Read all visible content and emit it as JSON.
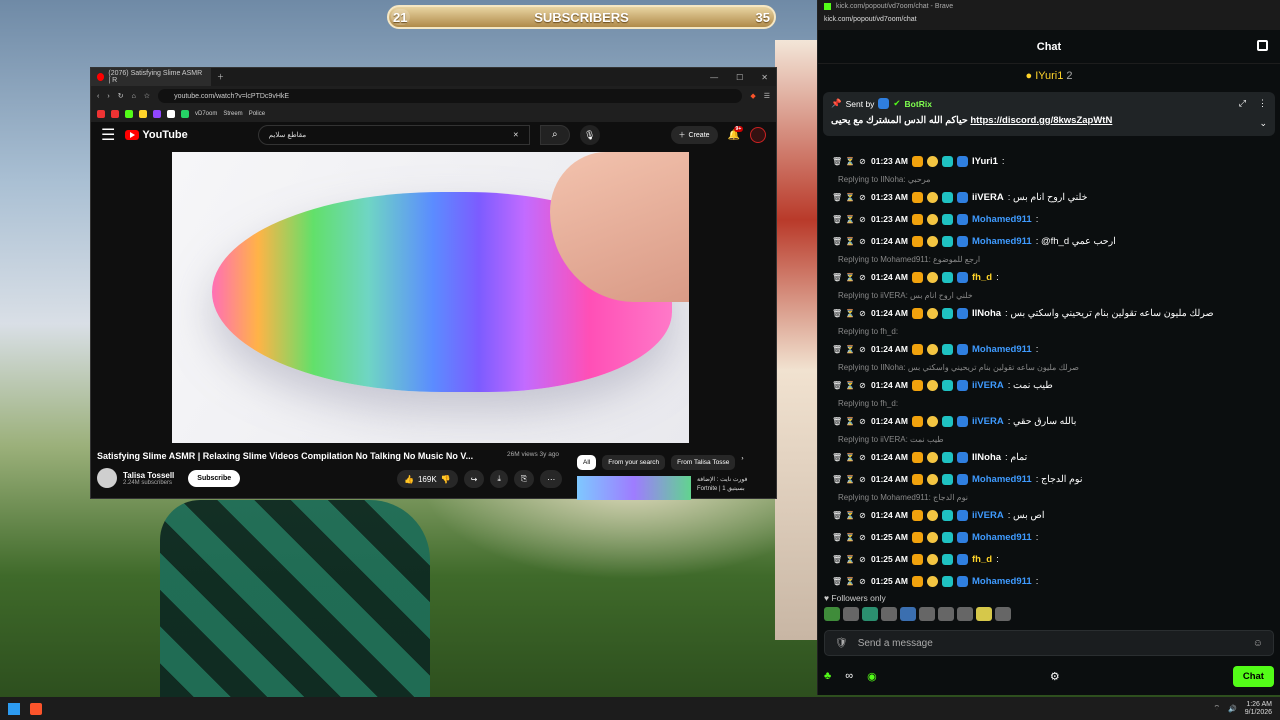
{
  "overlay": {
    "sub_start": "21",
    "sub_label": "SUBSCRIBERS",
    "sub_end": "35",
    "progress": 0.05
  },
  "browser": {
    "tab_title": "(2076) Satisfying Slime ASMR | R",
    "url": "youtube.com/watch?v=lcPTDc9vHkE",
    "bookmarks": [
      "vD7oom",
      "Streem",
      "Police"
    ]
  },
  "youtube": {
    "logo": "YouTube",
    "search_query": "مقاطع سلايم",
    "create_label": "Create",
    "notifications": "9+",
    "video_title": "Satisfying Slime ASMR | Relaxing Slime Videos Compilation No Talking No Music No V...",
    "views": "26M views",
    "age": "3y ago",
    "channel_name": "Talisa Tossell",
    "channel_subs": "2.24M subscribers",
    "subscribe_label": "Subscribe",
    "likes": "169K",
    "chips": [
      "All",
      "From your search",
      "From Talisa Tosse"
    ],
    "rec_line1": "فورت نايت : الإضافة",
    "rec_line2": "Fortnite | 1 بسيتيق"
  },
  "chat": {
    "window_title": "kick.com/popout/vd7oom/chat - Brave",
    "url": "kick.com/popout/vd7oom/chat",
    "header": "Chat",
    "pinned_user": "IYuri1",
    "pinned_count": "2",
    "sent_by": "Sent by",
    "bot_name": "BotRix",
    "pinned_message": "حياكم الله الدس المشترك مع يحيى",
    "pinned_link": "https://discord.gg/8kwsZapWtN",
    "messages": [
      {
        "reply": "",
        "time": "01:23 AM",
        "user": "IYuri1",
        "text": ":",
        "color": "#ffffff"
      },
      {
        "reply": "Replying to IlNoha: مرحبي",
        "time": "01:23 AM",
        "user": "iiVERA",
        "text": ": خلني اروح انام بس",
        "color": "#ffffff"
      },
      {
        "reply": "",
        "time": "01:23 AM",
        "user": "Mohamed911",
        "text": ":",
        "color": "#3f9bff"
      },
      {
        "reply": "",
        "time": "01:24 AM",
        "user": "Mohamed911",
        "text": ": @fh_d ارحب عمي",
        "color": "#3f9bff"
      },
      {
        "reply": "Replying to Mohamed911: ارجع للموضوع",
        "time": "01:24 AM",
        "user": "fh_d",
        "text": ":",
        "color": "#ffd42a"
      },
      {
        "reply": "Replying to iiVERA: خلني اروح انام بس",
        "time": "01:24 AM",
        "user": "IlNoha",
        "text": ": صرلك مليون ساعه تقولين بنام تريحيني واسكتي بس",
        "color": "#ffffff"
      },
      {
        "reply": "Replying to fh_d:",
        "time": "01:24 AM",
        "user": "Mohamed911",
        "text": ":",
        "color": "#3f9bff"
      },
      {
        "reply": "Replying to IlNoha: صرلك مليون ساعه تقولين بنام تريحيني واسكتي بس",
        "time": "01:24 AM",
        "user": "iiVERA",
        "text": ": طيب نمت",
        "color": "#3f9bff"
      },
      {
        "reply": "Replying to fh_d:",
        "time": "01:24 AM",
        "user": "iiVERA",
        "text": ": بالله سارق حقي",
        "color": "#3f9bff"
      },
      {
        "reply": "Replying to iiVERA: طيب نمت",
        "time": "01:24 AM",
        "user": "IlNoha",
        "text": ": تمام",
        "color": "#ffffff"
      },
      {
        "reply": "",
        "time": "01:24 AM",
        "user": "Mohamed911",
        "text": ": نوم الدجاج",
        "color": "#3f9bff"
      },
      {
        "reply": "Replying to Mohamed911: نوم الدجاج",
        "time": "01:24 AM",
        "user": "iiVERA",
        "text": ": اص بس",
        "color": "#3f9bff"
      },
      {
        "reply": "",
        "time": "01:25 AM",
        "user": "Mohamed911",
        "text": ":",
        "color": "#3f9bff"
      },
      {
        "reply": "",
        "time": "01:25 AM",
        "user": "fh_d",
        "text": ":",
        "color": "#ffd42a"
      },
      {
        "reply": "",
        "time": "01:25 AM",
        "user": "Mohamed911",
        "text": ":",
        "color": "#3f9bff"
      }
    ],
    "followers_only": "Followers only",
    "input_placeholder": "Send a message",
    "chat_button": "Chat"
  },
  "taskbar": {
    "time": "1:26 AM",
    "date": "9/1/2026"
  }
}
